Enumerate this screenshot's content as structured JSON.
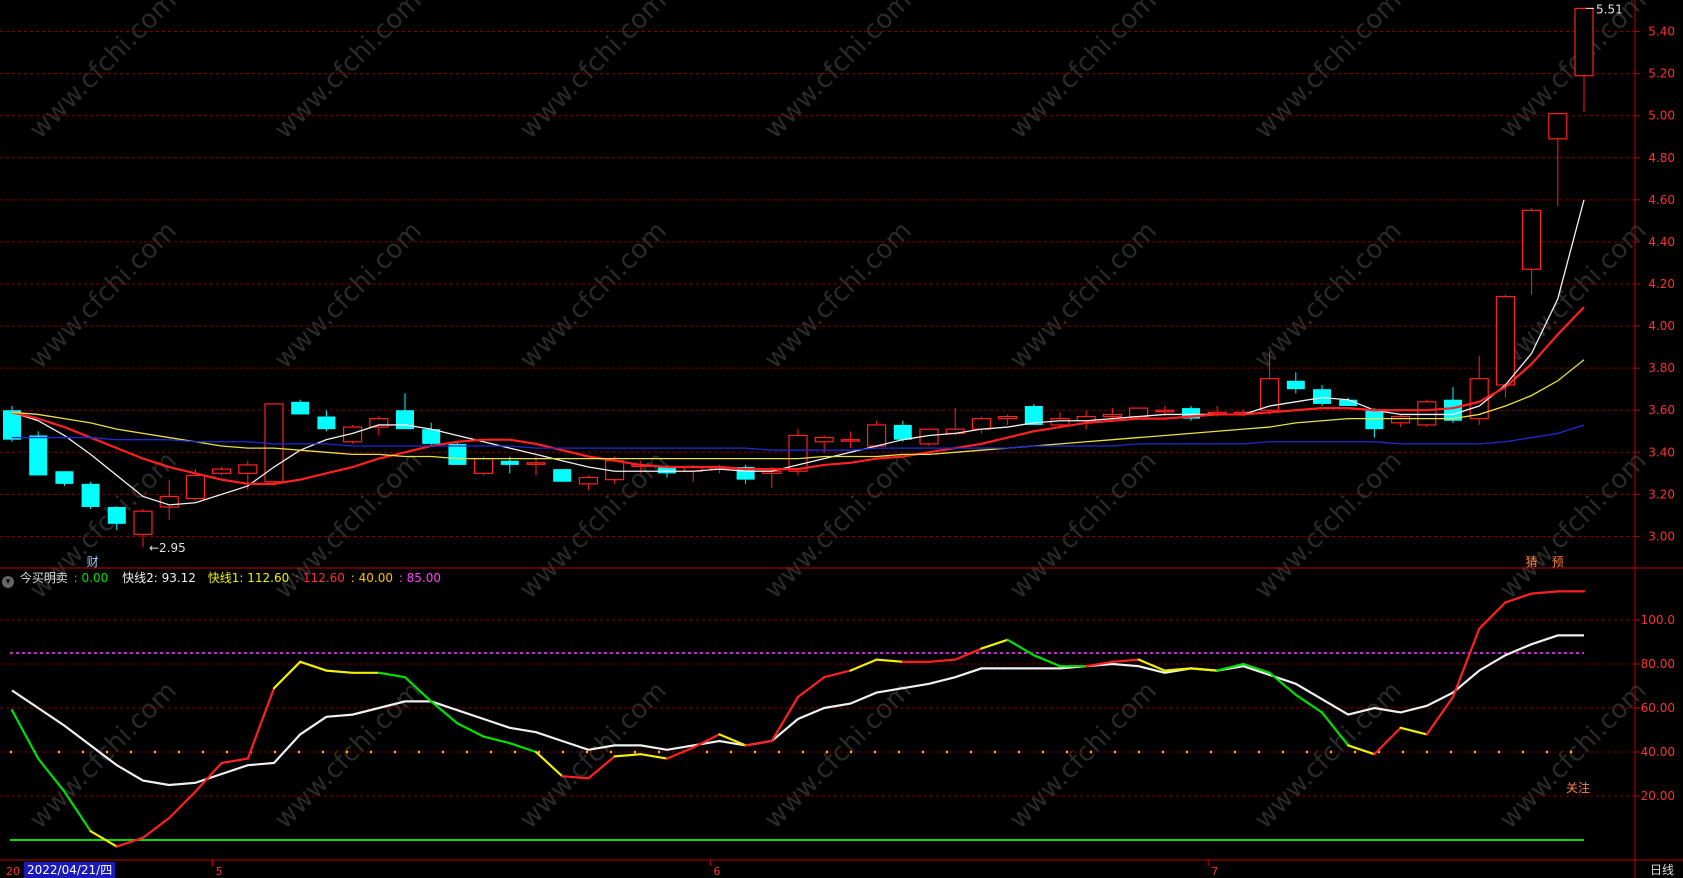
{
  "chart_data": [
    {
      "type": "candlestick",
      "title": "",
      "ylim": [
        2.85,
        5.55
      ],
      "yticks": [
        "3.00",
        "3.20",
        "3.40",
        "3.60",
        "3.80",
        "4.00",
        "4.20",
        "4.40",
        "4.60",
        "4.80",
        "5.00",
        "5.20",
        "5.40"
      ],
      "candles": [
        {
          "o": 3.6,
          "h": 3.62,
          "l": 3.45,
          "c": 3.46
        },
        {
          "o": 3.48,
          "h": 3.5,
          "l": 3.29,
          "c": 3.29
        },
        {
          "o": 3.31,
          "h": 3.31,
          "l": 3.24,
          "c": 3.25
        },
        {
          "o": 3.25,
          "h": 3.26,
          "l": 3.13,
          "c": 3.14
        },
        {
          "o": 3.14,
          "h": 3.14,
          "l": 3.03,
          "c": 3.06
        },
        {
          "o": 3.01,
          "h": 3.13,
          "l": 2.95,
          "c": 3.12
        },
        {
          "o": 3.14,
          "h": 3.27,
          "l": 3.08,
          "c": 3.19
        },
        {
          "o": 3.18,
          "h": 3.32,
          "l": 3.17,
          "c": 3.29
        },
        {
          "o": 3.3,
          "h": 3.33,
          "l": 3.29,
          "c": 3.32
        },
        {
          "o": 3.3,
          "h": 3.36,
          "l": 3.22,
          "c": 3.34
        },
        {
          "o": 3.26,
          "h": 3.63,
          "l": 3.24,
          "c": 3.63
        },
        {
          "o": 3.64,
          "h": 3.65,
          "l": 3.58,
          "c": 3.58
        },
        {
          "o": 3.57,
          "h": 3.6,
          "l": 3.5,
          "c": 3.51
        },
        {
          "o": 3.45,
          "h": 3.53,
          "l": 3.44,
          "c": 3.52
        },
        {
          "o": 3.52,
          "h": 3.57,
          "l": 3.48,
          "c": 3.56
        },
        {
          "o": 3.6,
          "h": 3.68,
          "l": 3.51,
          "c": 3.51
        },
        {
          "o": 3.51,
          "h": 3.54,
          "l": 3.43,
          "c": 3.44
        },
        {
          "o": 3.44,
          "h": 3.45,
          "l": 3.34,
          "c": 3.34
        },
        {
          "o": 3.3,
          "h": 3.38,
          "l": 3.29,
          "c": 3.37
        },
        {
          "o": 3.36,
          "h": 3.38,
          "l": 3.3,
          "c": 3.34
        },
        {
          "o": 3.35,
          "h": 3.38,
          "l": 3.29,
          "c": 3.35
        },
        {
          "o": 3.32,
          "h": 3.32,
          "l": 3.26,
          "c": 3.26
        },
        {
          "o": 3.25,
          "h": 3.29,
          "l": 3.22,
          "c": 3.28
        },
        {
          "o": 3.27,
          "h": 3.38,
          "l": 3.25,
          "c": 3.36
        },
        {
          "o": 3.34,
          "h": 3.36,
          "l": 3.3,
          "c": 3.34
        },
        {
          "o": 3.33,
          "h": 3.34,
          "l": 3.28,
          "c": 3.3
        },
        {
          "o": 3.31,
          "h": 3.34,
          "l": 3.26,
          "c": 3.33
        },
        {
          "o": 3.32,
          "h": 3.34,
          "l": 3.3,
          "c": 3.33
        },
        {
          "o": 3.33,
          "h": 3.34,
          "l": 3.25,
          "c": 3.27
        },
        {
          "o": 3.3,
          "h": 3.33,
          "l": 3.23,
          "c": 3.31
        },
        {
          "o": 3.31,
          "h": 3.51,
          "l": 3.29,
          "c": 3.48
        },
        {
          "o": 3.45,
          "h": 3.48,
          "l": 3.4,
          "c": 3.47
        },
        {
          "o": 3.46,
          "h": 3.5,
          "l": 3.42,
          "c": 3.46
        },
        {
          "o": 3.43,
          "h": 3.55,
          "l": 3.42,
          "c": 3.53
        },
        {
          "o": 3.53,
          "h": 3.55,
          "l": 3.45,
          "c": 3.46
        },
        {
          "o": 3.44,
          "h": 3.51,
          "l": 3.43,
          "c": 3.51
        },
        {
          "o": 3.49,
          "h": 3.61,
          "l": 3.48,
          "c": 3.51
        },
        {
          "o": 3.51,
          "h": 3.57,
          "l": 3.49,
          "c": 3.56
        },
        {
          "o": 3.56,
          "h": 3.58,
          "l": 3.53,
          "c": 3.57
        },
        {
          "o": 3.62,
          "h": 3.63,
          "l": 3.53,
          "c": 3.53
        },
        {
          "o": 3.53,
          "h": 3.59,
          "l": 3.52,
          "c": 3.56
        },
        {
          "o": 3.55,
          "h": 3.6,
          "l": 3.51,
          "c": 3.57
        },
        {
          "o": 3.57,
          "h": 3.61,
          "l": 3.55,
          "c": 3.58
        },
        {
          "o": 3.57,
          "h": 3.61,
          "l": 3.57,
          "c": 3.61
        },
        {
          "o": 3.6,
          "h": 3.62,
          "l": 3.57,
          "c": 3.6
        },
        {
          "o": 3.61,
          "h": 3.62,
          "l": 3.55,
          "c": 3.56
        },
        {
          "o": 3.59,
          "h": 3.62,
          "l": 3.57,
          "c": 3.59
        },
        {
          "o": 3.59,
          "h": 3.6,
          "l": 3.57,
          "c": 3.59
        },
        {
          "o": 3.6,
          "h": 3.88,
          "l": 3.58,
          "c": 3.75
        },
        {
          "o": 3.74,
          "h": 3.78,
          "l": 3.68,
          "c": 3.7
        },
        {
          "o": 3.7,
          "h": 3.72,
          "l": 3.62,
          "c": 3.63
        },
        {
          "o": 3.65,
          "h": 3.66,
          "l": 3.62,
          "c": 3.62
        },
        {
          "o": 3.6,
          "h": 3.61,
          "l": 3.47,
          "c": 3.51
        },
        {
          "o": 3.54,
          "h": 3.58,
          "l": 3.52,
          "c": 3.57
        },
        {
          "o": 3.53,
          "h": 3.65,
          "l": 3.52,
          "c": 3.64
        },
        {
          "o": 3.65,
          "h": 3.71,
          "l": 3.54,
          "c": 3.55
        },
        {
          "o": 3.56,
          "h": 3.86,
          "l": 3.53,
          "c": 3.75
        },
        {
          "o": 3.72,
          "h": 4.15,
          "l": 3.66,
          "c": 4.14
        },
        {
          "o": 4.27,
          "h": 4.56,
          "l": 4.15,
          "c": 4.55
        },
        {
          "o": 4.89,
          "h": 5.01,
          "l": 4.57,
          "c": 5.01
        },
        {
          "o": 5.19,
          "h": 5.51,
          "l": 5.02,
          "c": 5.51
        }
      ],
      "series": [
        {
          "name": "",
          "color": "#f0f0f0",
          "values": [
            3.59,
            3.55,
            3.48,
            3.39,
            3.29,
            3.19,
            3.15,
            3.16,
            3.2,
            3.24,
            3.33,
            3.41,
            3.46,
            3.49,
            3.53,
            3.53,
            3.51,
            3.48,
            3.45,
            3.42,
            3.39,
            3.36,
            3.33,
            3.31,
            3.31,
            3.31,
            3.31,
            3.32,
            3.31,
            3.31,
            3.34,
            3.37,
            3.4,
            3.43,
            3.46,
            3.48,
            3.49,
            3.51,
            3.52,
            3.54,
            3.55,
            3.55,
            3.56,
            3.57,
            3.58,
            3.58,
            3.58,
            3.58,
            3.62,
            3.64,
            3.66,
            3.65,
            3.6,
            3.58,
            3.58,
            3.58,
            3.62,
            3.72,
            3.87,
            4.13,
            4.6
          ]
        },
        {
          "name": "",
          "color": "#ff2020",
          "values": [
            3.59,
            3.56,
            3.52,
            3.47,
            3.42,
            3.37,
            3.33,
            3.3,
            3.27,
            3.25,
            3.25,
            3.27,
            3.3,
            3.33,
            3.37,
            3.4,
            3.43,
            3.45,
            3.46,
            3.46,
            3.44,
            3.41,
            3.38,
            3.36,
            3.34,
            3.33,
            3.33,
            3.33,
            3.32,
            3.32,
            3.32,
            3.34,
            3.35,
            3.37,
            3.38,
            3.4,
            3.42,
            3.44,
            3.47,
            3.5,
            3.52,
            3.54,
            3.55,
            3.56,
            3.56,
            3.57,
            3.58,
            3.58,
            3.59,
            3.6,
            3.61,
            3.61,
            3.6,
            3.6,
            3.6,
            3.61,
            3.64,
            3.71,
            3.82,
            3.96,
            4.09
          ]
        },
        {
          "name": "",
          "color": "#e8e040",
          "values": [
            3.59,
            3.58,
            3.56,
            3.54,
            3.51,
            3.49,
            3.47,
            3.45,
            3.43,
            3.42,
            3.42,
            3.41,
            3.4,
            3.39,
            3.39,
            3.38,
            3.38,
            3.37,
            3.37,
            3.37,
            3.37,
            3.37,
            3.37,
            3.37,
            3.37,
            3.37,
            3.37,
            3.37,
            3.37,
            3.37,
            3.37,
            3.38,
            3.38,
            3.38,
            3.39,
            3.39,
            3.4,
            3.41,
            3.42,
            3.43,
            3.44,
            3.45,
            3.46,
            3.47,
            3.48,
            3.49,
            3.5,
            3.51,
            3.52,
            3.54,
            3.55,
            3.56,
            3.56,
            3.56,
            3.56,
            3.56,
            3.58,
            3.62,
            3.67,
            3.74,
            3.84
          ]
        },
        {
          "name": "",
          "color": "#1e2bd8",
          "values": [
            3.47,
            3.47,
            3.47,
            3.47,
            3.46,
            3.46,
            3.46,
            3.45,
            3.45,
            3.45,
            3.44,
            3.44,
            3.44,
            3.43,
            3.43,
            3.43,
            3.43,
            3.43,
            3.43,
            3.43,
            3.42,
            3.42,
            3.42,
            3.42,
            3.42,
            3.42,
            3.42,
            3.42,
            3.42,
            3.41,
            3.41,
            3.41,
            3.41,
            3.42,
            3.42,
            3.42,
            3.42,
            3.42,
            3.42,
            3.43,
            3.43,
            3.43,
            3.43,
            3.44,
            3.44,
            3.44,
            3.44,
            3.44,
            3.45,
            3.45,
            3.45,
            3.45,
            3.45,
            3.44,
            3.44,
            3.44,
            3.44,
            3.45,
            3.47,
            3.49,
            3.53
          ]
        }
      ],
      "annotations": {
        "low": "2.95",
        "high": "5.51",
        "event_label": "财",
        "right_labels": [
          "猜",
          "预"
        ]
      }
    },
    {
      "type": "line",
      "title": "",
      "ylim": [
        0,
        125
      ],
      "yticks": [
        "20.00",
        "40.00",
        "60.00",
        "80.00",
        "100.0"
      ],
      "header": {
        "name": "今买明卖",
        "v0_label": ": 0.00",
        "fast2_label": "快线2: 93.12",
        "fast1_label": "快线1: 112.60",
        "red_label": ": 112.60",
        "lvl40_label": ": 40.00",
        "lvl85_label": ": 85.00"
      },
      "fast1": [
        59,
        37,
        22,
        4,
        -3,
        1,
        10,
        22,
        35,
        37,
        69,
        81,
        77,
        76,
        76,
        74,
        63,
        53,
        47,
        44,
        40,
        29,
        28,
        38,
        39,
        37,
        42,
        48,
        43,
        45,
        65,
        74,
        77,
        82,
        81,
        81,
        82,
        87,
        91,
        84,
        79,
        79,
        81,
        82,
        77,
        78,
        77,
        80,
        76,
        66,
        58,
        43,
        39,
        51,
        48,
        65,
        96,
        108,
        112,
        113,
        113
      ],
      "fast1_state": [
        "g",
        "g",
        "g",
        "g",
        "y",
        "r",
        "r",
        "r",
        "r",
        "r",
        "r",
        "y",
        "y",
        "y",
        "y",
        "g",
        "g",
        "g",
        "g",
        "g",
        "g",
        "y",
        "r",
        "r",
        "y",
        "y",
        "r",
        "r",
        "y",
        "r",
        "r",
        "r",
        "r",
        "y",
        "y",
        "r",
        "r",
        "r",
        "y",
        "g",
        "g",
        "g",
        "r",
        "r",
        "y",
        "y",
        "y",
        "g",
        "g",
        "g",
        "g",
        "g",
        "y",
        "r",
        "y",
        "r",
        "r",
        "r",
        "r",
        "r",
        "r"
      ],
      "fast2": [
        68,
        60,
        52,
        43,
        34,
        27,
        25,
        26,
        30,
        34,
        35,
        48,
        56,
        57,
        60,
        63,
        63,
        59,
        55,
        51,
        49,
        45,
        41,
        43,
        43,
        41,
        43,
        45,
        43,
        45,
        55,
        60,
        62,
        67,
        69,
        71,
        74,
        78,
        78,
        78,
        78,
        79,
        80,
        79,
        76,
        78,
        77,
        79,
        75,
        71,
        64,
        57,
        60,
        58,
        61,
        67,
        77,
        84,
        89,
        93,
        93
      ],
      "levels": {
        "v0": 0,
        "lvl40": 40,
        "lvl85": 85
      },
      "annotation": "关注"
    }
  ],
  "xaxis": {
    "left_label": "20",
    "date_label": "2022/04/21/四",
    "months": [
      "5",
      "6",
      "7"
    ],
    "period_label": "日线"
  },
  "colors": {
    "up": "#ff2020",
    "down": "#00ffff",
    "grid": "#7a0000",
    "axis": "#c00000",
    "green": "#00e000",
    "yellow": "#f0f000",
    "red": "#ff2020",
    "white": "#f0f0f0",
    "magenta_dotted": "#ff40ff",
    "orange_dotted": "#ffc000",
    "tick_text": "#ff3030"
  },
  "watermark": "www.cfchi.com"
}
